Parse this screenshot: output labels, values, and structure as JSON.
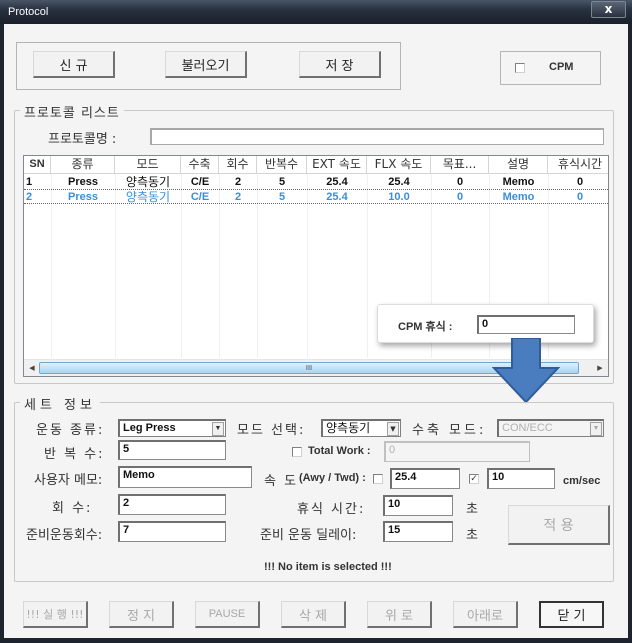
{
  "window": {
    "title": "Protocol",
    "close_label": "x"
  },
  "top_toolbar": {
    "new_label": "신 규",
    "load_label": "불러오기",
    "save_label": "저 장",
    "cpm_label": "CPM",
    "cpm_checked": false
  },
  "protocol_list": {
    "group_title": "프로토콜 리스트",
    "name_label": "프로토콜명 :",
    "name_value": "",
    "columns": [
      "SN",
      "종류",
      "모드",
      "수축",
      "회수",
      "반복수",
      "EXT 속도",
      "FLX 속도",
      "목표...",
      "설명",
      "휴식시간"
    ],
    "rows": [
      {
        "sn": "1",
        "type": "Press",
        "mode": "양측동기",
        "contraction": "C/E",
        "sets": "2",
        "reps": "5",
        "ext_speed": "25.4",
        "flx_speed": "25.4",
        "target": "0",
        "desc": "Memo",
        "rest": "0",
        "selected": false
      },
      {
        "sn": "2",
        "type": "Press",
        "mode": "양측동기",
        "contraction": "C/E",
        "sets": "2",
        "reps": "5",
        "ext_speed": "25.4",
        "flx_speed": "10.0",
        "target": "0",
        "desc": "Memo",
        "rest": "0",
        "selected": true
      }
    ],
    "scroll_thumb_glyph": "III"
  },
  "callout": {
    "label": "CPM 휴식 :",
    "value": "0"
  },
  "set_info": {
    "group_title": "세트 정보",
    "exercise_type_label": "운동 종류:",
    "exercise_type_value": "Leg Press",
    "mode_select_label": "모드 선택:",
    "mode_select_value": "양측동기",
    "contraction_mode_label": "수축 모드:",
    "contraction_mode_value": "CON/ECC",
    "reps_label": "반 복 수:",
    "reps_value": "5",
    "total_work_label": "Total Work :",
    "total_work_checked": false,
    "total_work_value": "0",
    "memo_label": "사용자 메모:",
    "memo_value": "Memo",
    "speed_label_ko": "속 도",
    "speed_label_en": "(Awy / Twd) :",
    "speed_away_checked": false,
    "speed_away_value": "25.4",
    "speed_toward_checked": true,
    "speed_toward_value": "10",
    "speed_unit": "cm/sec",
    "sets_label": "회 수:",
    "sets_value": "2",
    "rest_time_label": "휴식 시간:",
    "rest_time_value": "10",
    "rest_time_unit": "초",
    "warmup_count_label": "준비운동회수:",
    "warmup_count_value": "7",
    "warmup_delay_label": "준비 운동 딜레이:",
    "warmup_delay_value": "15",
    "warmup_delay_unit": "초",
    "apply_label": "적 용",
    "status_message": "!!! No item is selected !!!"
  },
  "bottom_toolbar": {
    "run_label": "!!! 실 행 !!!",
    "stop_label": "정 지",
    "pause_label": "PAUSE",
    "delete_label": "삭 제",
    "up_label": "위 로",
    "down_label": "아래로",
    "close_label": "닫 기"
  },
  "colors": {
    "selected_row": "#3a8fd8",
    "arrow_fill": "#4a7cc0",
    "arrow_stroke": "#2f5d99"
  }
}
